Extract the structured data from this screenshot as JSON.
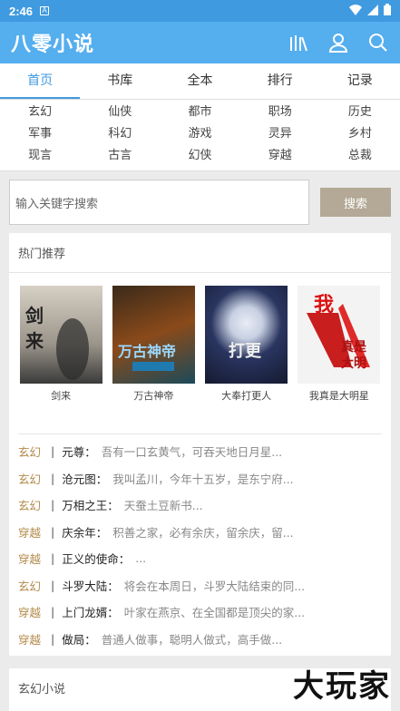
{
  "status": {
    "time": "2:46",
    "notif_icon": "A"
  },
  "app": {
    "title": "八零小说"
  },
  "tabs": [
    "首页",
    "书库",
    "全本",
    "排行",
    "记录"
  ],
  "categories": [
    "玄幻",
    "仙侠",
    "都市",
    "职场",
    "历史",
    "军事",
    "科幻",
    "游戏",
    "灵异",
    "乡村",
    "现言",
    "古言",
    "幻侠",
    "穿越",
    "总裁"
  ],
  "search": {
    "placeholder": "输入关键字搜索",
    "button": "搜索"
  },
  "hot": {
    "title": "热门推荐",
    "books": [
      {
        "name": "剑来",
        "cover_text": "剑来",
        "colors": [
          "#c9c2b5",
          "#4a4a4a"
        ]
      },
      {
        "name": "万古神帝",
        "cover_text": "万古神帝",
        "colors": [
          "#6b3a1a",
          "#1c5a7a"
        ]
      },
      {
        "name": "大奉打更人",
        "cover_text": "打更人",
        "colors": [
          "#1d2a4a",
          "#8a97b5"
        ]
      },
      {
        "name": "我真是大明星",
        "cover_text": "我真是大明星",
        "colors": [
          "#f2f2f2",
          "#c41a1a"
        ]
      }
    ]
  },
  "list": [
    {
      "genre": "玄幻",
      "title": "元尊：",
      "desc": "吾有一口玄黄气，可吞天地日月星..."
    },
    {
      "genre": "玄幻",
      "title": "沧元图：",
      "desc": "我叫孟川，今年十五岁，是东宁府..."
    },
    {
      "genre": "玄幻",
      "title": "万相之王：",
      "desc": "天蚕土豆新书..."
    },
    {
      "genre": "穿越",
      "title": "庆余年：",
      "desc": "积善之家，必有余庆，留余庆，留..."
    },
    {
      "genre": "穿越",
      "title": "正义的使命：",
      "desc": "..."
    },
    {
      "genre": "玄幻",
      "title": "斗罗大陆：",
      "desc": "将会在本周日，斗罗大陆结束的同..."
    },
    {
      "genre": "穿越",
      "title": "上门龙婿：",
      "desc": "叶家在燕京、在全国都是顶尖的家..."
    },
    {
      "genre": "穿越",
      "title": "做局：",
      "desc": "普通人做事，聪明人做式，高手做..."
    }
  ],
  "section2": {
    "title": "玄幻小说"
  },
  "watermark": "大玩家"
}
